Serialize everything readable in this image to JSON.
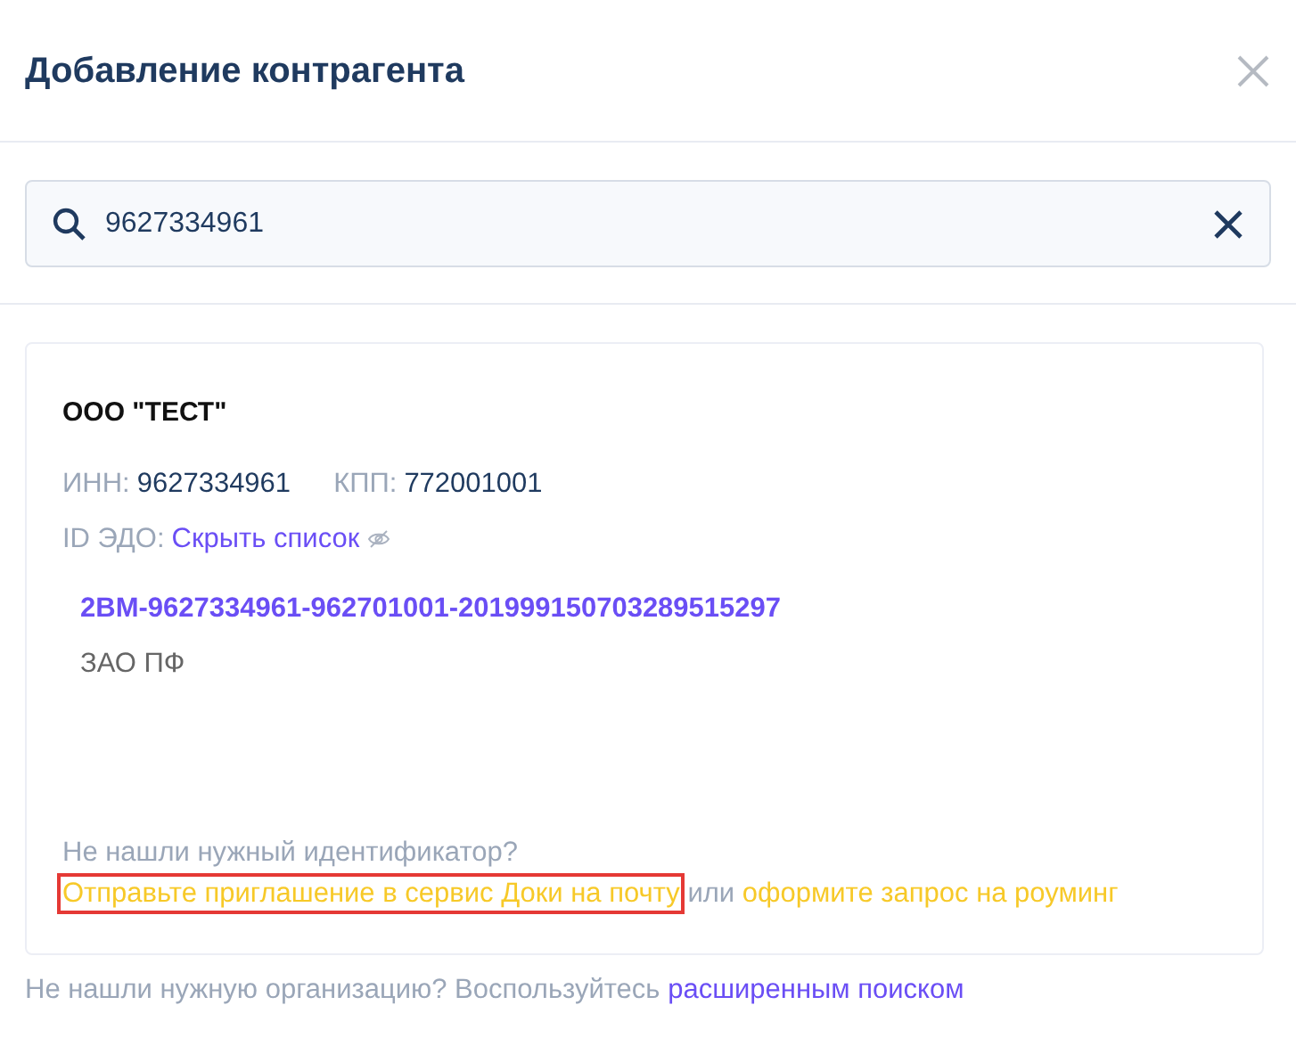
{
  "dialog": {
    "title": "Добавление контрагента"
  },
  "search": {
    "value": "9627334961"
  },
  "result": {
    "name": "ООО \"ТЕСТ\"",
    "fields": [
      {
        "label": "ИНН:",
        "value": "9627334961"
      },
      {
        "label": "КПП:",
        "value": "772001001"
      }
    ],
    "edo": {
      "label": "ID ЭДО:",
      "toggle": "Скрыть список",
      "items": [
        {
          "id": "2BM-9627334961-962701001-201999150703289515297",
          "operator": "ЗАО ПФ"
        }
      ]
    },
    "hint": {
      "question": "Не нашли нужный идентификатор?",
      "parts": [
        {
          "kind": "link",
          "text": "Отправьте приглашение в сервис Доки на почту",
          "highlighted": true
        },
        {
          "kind": "text",
          "text": "или"
        },
        {
          "kind": "link",
          "text": "оформите запрос на роуминг",
          "highlighted": false
        }
      ]
    }
  },
  "footer": {
    "text": "Не нашли нужную организацию? Воспользуйтесь",
    "link": "расширенным поиском"
  }
}
